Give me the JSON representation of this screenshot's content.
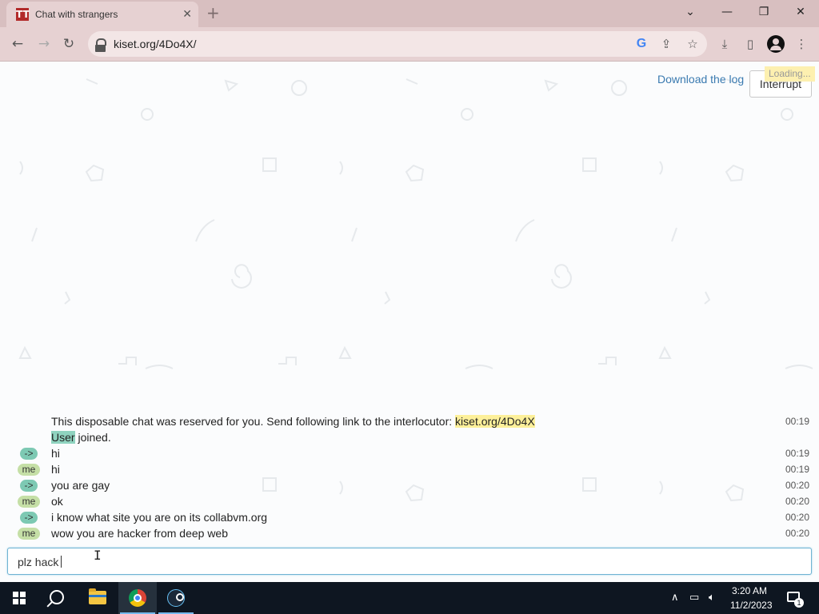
{
  "browser": {
    "tab_title": "Chat with strangers",
    "favicon": "TT",
    "url": "kiset.org/4Do4X/",
    "icons": [
      "back-icon",
      "forward-icon",
      "reload-icon",
      "lock-icon",
      "google-icon",
      "share-icon",
      "star-icon",
      "download-icon",
      "side-panel-icon",
      "profile-icon",
      "kebab-menu-icon"
    ]
  },
  "page": {
    "download_log": "Download the log",
    "interrupt": "Interrupt",
    "loading": "Loading..."
  },
  "chat": {
    "system": {
      "text": "This disposable chat was reserved for you. Send following link to the interlocutor:",
      "link": "kiset.org/4Do4X",
      "time": "00:19"
    },
    "joined": {
      "user": "User",
      "text": "joined."
    },
    "messages": [
      {
        "who": "->",
        "text": "hi",
        "time": "00:19"
      },
      {
        "who": "me",
        "text": "hi",
        "time": "00:19"
      },
      {
        "who": "->",
        "text": "you are gay",
        "time": "00:20"
      },
      {
        "who": "me",
        "text": "ok",
        "time": "00:20"
      },
      {
        "who": "->",
        "text": "i know what site you are on its collabvm.org",
        "time": "00:20"
      },
      {
        "who": "me",
        "text": "wow you are hacker from deep web",
        "time": "00:20"
      }
    ],
    "input_value": "plz hack"
  },
  "taskbar": {
    "time": "3:20 AM",
    "date": "11/2/2023",
    "notifications": "1",
    "colors": {
      "background": "#0e1621",
      "active_indicator": "#76b9ed"
    }
  },
  "colors": {
    "highlight_link": "#fdf09a",
    "highlight_user": "#8fd3bf",
    "badge_them": "#7dc9b3",
    "badge_me": "#c5dfa6",
    "link": "#3a7ab0"
  }
}
